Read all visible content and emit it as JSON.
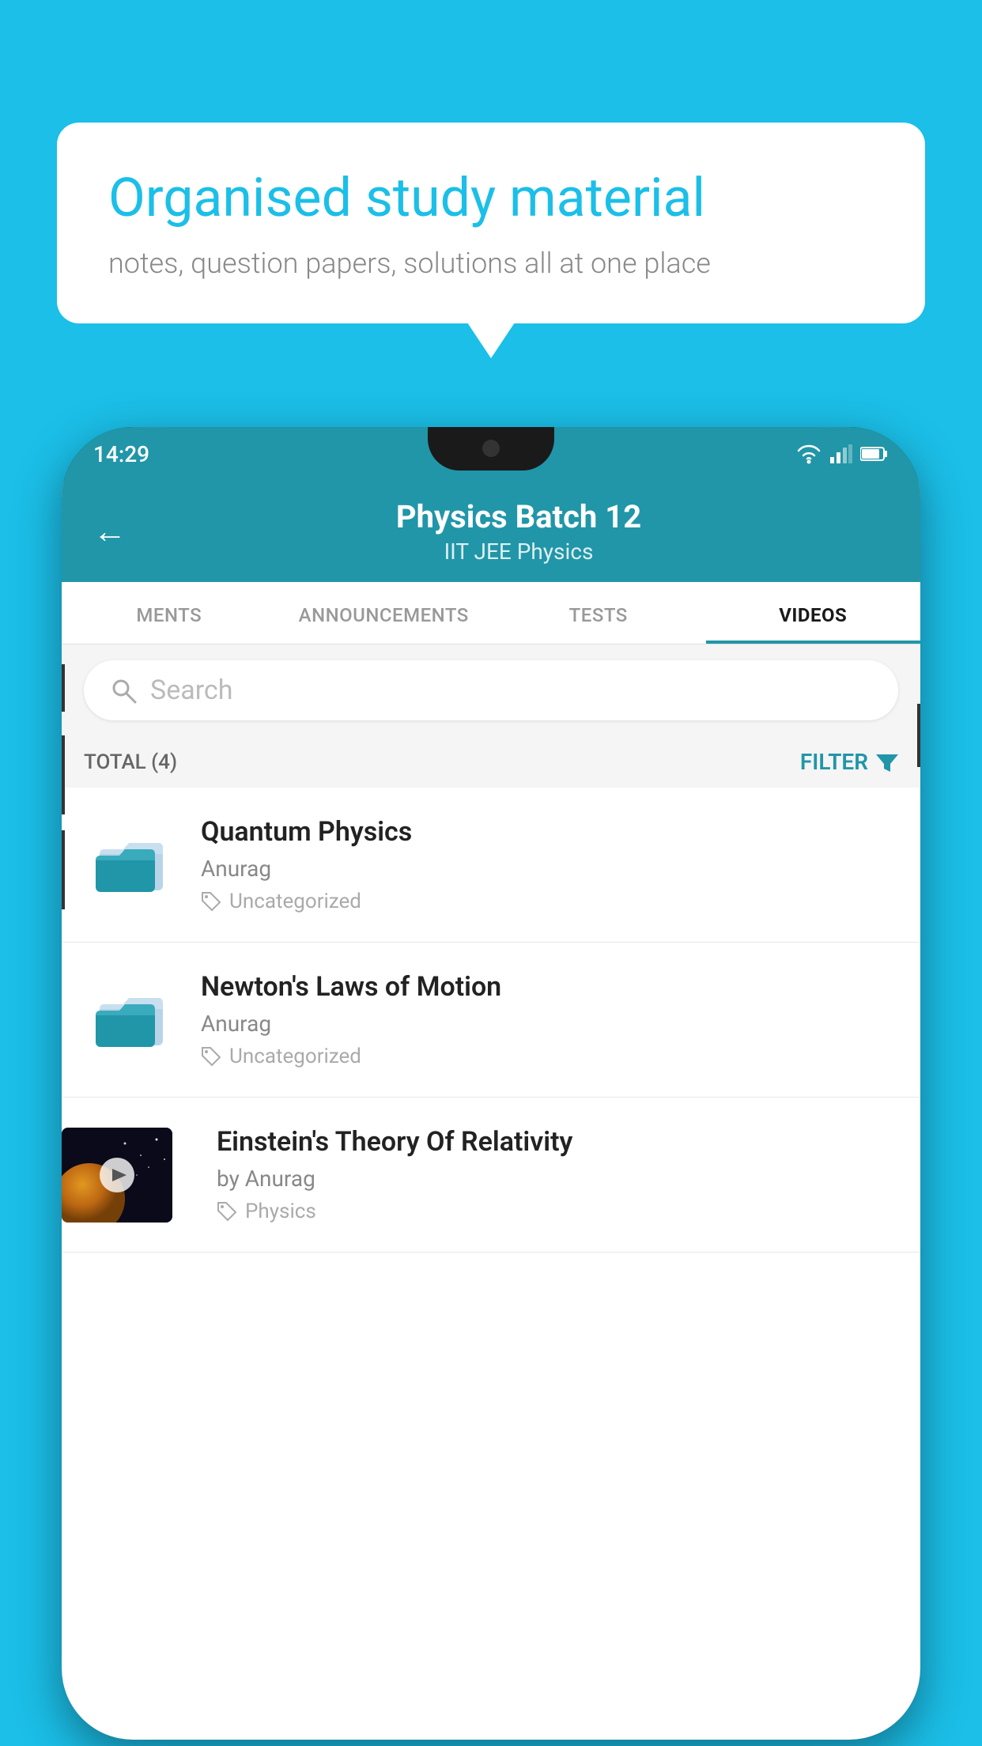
{
  "background_color": "#1bbfe8",
  "speech_bubble": {
    "title": "Organised study material",
    "subtitle": "notes, question papers, solutions all at one place"
  },
  "status_bar": {
    "time": "14:29",
    "icons": [
      "wifi",
      "signal",
      "battery"
    ]
  },
  "app_header": {
    "title": "Physics Batch 12",
    "subtitle": "IIT JEE   Physics",
    "back_label": "←"
  },
  "tabs": [
    {
      "label": "MENTS",
      "active": false
    },
    {
      "label": "ANNOUNCEMENTS",
      "active": false
    },
    {
      "label": "TESTS",
      "active": false
    },
    {
      "label": "VIDEOS",
      "active": true
    }
  ],
  "search": {
    "placeholder": "Search"
  },
  "filter_bar": {
    "total_label": "TOTAL (4)",
    "filter_label": "FILTER"
  },
  "video_items": [
    {
      "id": 1,
      "title": "Quantum Physics",
      "author": "Anurag",
      "tag": "Uncategorized",
      "type": "folder",
      "has_thumbnail": false
    },
    {
      "id": 2,
      "title": "Newton's Laws of Motion",
      "author": "Anurag",
      "tag": "Uncategorized",
      "type": "folder",
      "has_thumbnail": false
    },
    {
      "id": 3,
      "title": "Einstein's Theory Of Relativity",
      "author": "by Anurag",
      "tag": "Physics",
      "type": "video",
      "has_thumbnail": true
    }
  ]
}
